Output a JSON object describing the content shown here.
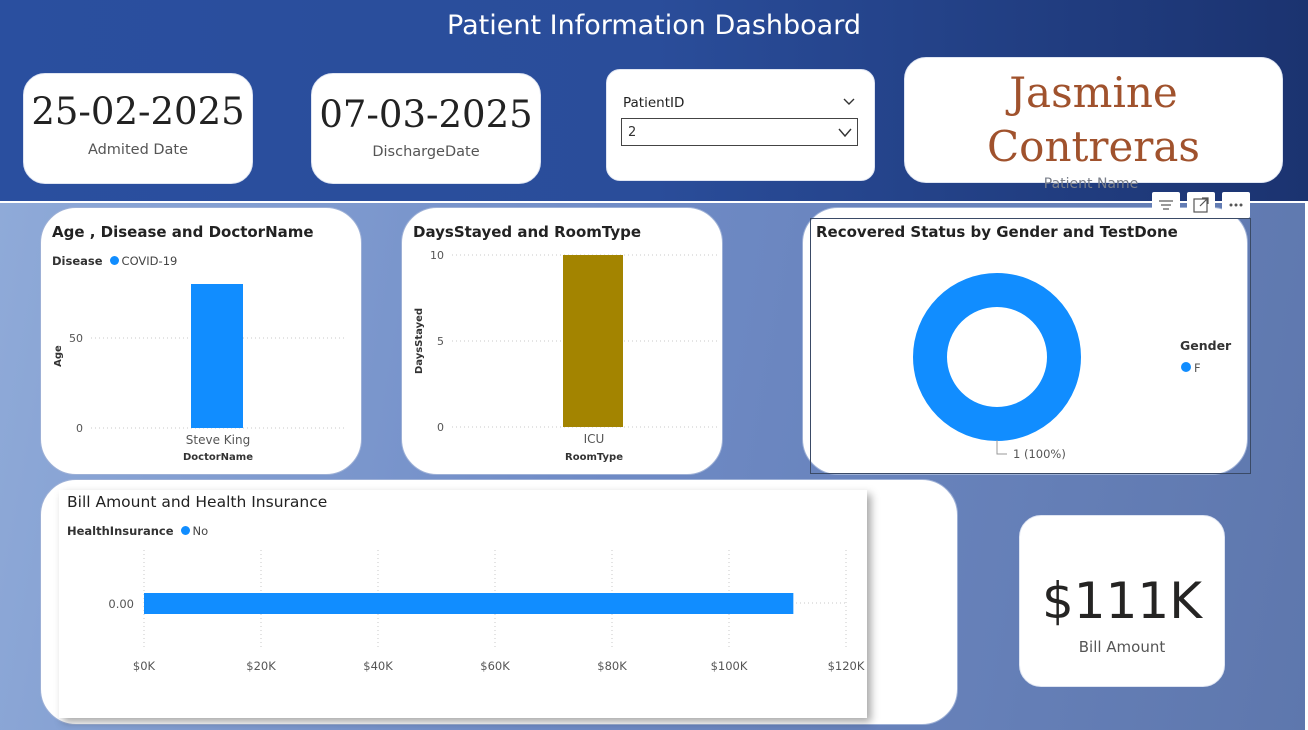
{
  "header": {
    "title": "Patient Information Dashboard"
  },
  "admitted": {
    "value": "25-02-2025",
    "label": "Admited Date"
  },
  "discharge": {
    "value": "07-03-2025",
    "label": "DischargeDate"
  },
  "slicer": {
    "label": "PatientID",
    "value": "2"
  },
  "patient": {
    "name_line1": "Jasmine",
    "name_line2": "Contreras",
    "caption": "Patient Name"
  },
  "visual_header_icons": [
    "filter-icon",
    "focus-mode-icon",
    "more-options-icon"
  ],
  "colors": {
    "series_blue": "#118dff",
    "icu_bar": "#a38400",
    "name_text": "#a0522d",
    "header_bg": "#2a4f9f"
  },
  "kpi": {
    "value": "$111K",
    "label": "Bill Amount"
  },
  "chart_data": [
    {
      "type": "bar",
      "title": "Age , Disease and DoctorName",
      "legend_title": "Disease",
      "categories": [
        "Steve King"
      ],
      "series": [
        {
          "name": "COVID-19",
          "values": [
            80
          ]
        }
      ],
      "xlabel": "DoctorName",
      "ylabel": "Age",
      "yticks": [
        "0",
        "50"
      ],
      "ylim": [
        0,
        90
      ],
      "grid": true
    },
    {
      "type": "bar",
      "title": "DaysStayed and RoomType",
      "categories": [
        "ICU"
      ],
      "values": [
        10
      ],
      "xlabel": "RoomType",
      "ylabel": "DaysStayed",
      "yticks": [
        "0",
        "5",
        "10"
      ],
      "ylim": [
        0,
        10
      ],
      "grid": true
    },
    {
      "type": "pie",
      "title": "Recovered Status by Gender and TestDone",
      "legend_title": "Gender",
      "series": [
        {
          "name": "F",
          "values": [
            1
          ]
        }
      ],
      "data_label": "1 (100%)"
    },
    {
      "type": "bar",
      "orientation": "horizontal",
      "title": "Bill Amount and Health Insurance",
      "legend_title": "HealthInsurance",
      "categories": [
        "0.00"
      ],
      "series": [
        {
          "name": "No",
          "values": [
            111000
          ]
        }
      ],
      "xticks": [
        "$0K",
        "$20K",
        "$40K",
        "$60K",
        "$80K",
        "$100K",
        "$120K"
      ],
      "xlim": [
        0,
        120000
      ],
      "grid": true
    }
  ]
}
